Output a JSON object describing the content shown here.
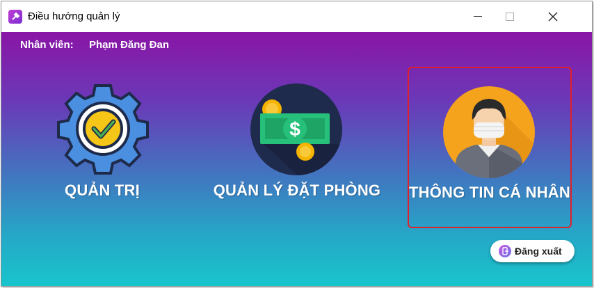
{
  "window": {
    "title": "Điều hướng quản lý",
    "controls": {
      "minimize": "—",
      "maximize": "☐",
      "close": "✕"
    }
  },
  "employee": {
    "label": "Nhân viên:",
    "name": "Phạm Đăng Đan"
  },
  "tiles": [
    {
      "label": "QUẢN TRỊ",
      "icon": "gear-check-icon",
      "selected": false
    },
    {
      "label": "QUẢN LÝ ĐẶT PHÒNG",
      "icon": "money-icon",
      "selected": false
    },
    {
      "label": "THÔNG TIN CÁ NHÂN",
      "icon": "user-avatar-icon",
      "selected": true
    }
  ],
  "logout": {
    "label": "Đăng xuất",
    "icon": "logout-icon"
  },
  "colors": {
    "gradient_top": "#8a15a6",
    "gradient_bottom": "#18c5cc",
    "selection_border": "#e0202a"
  }
}
